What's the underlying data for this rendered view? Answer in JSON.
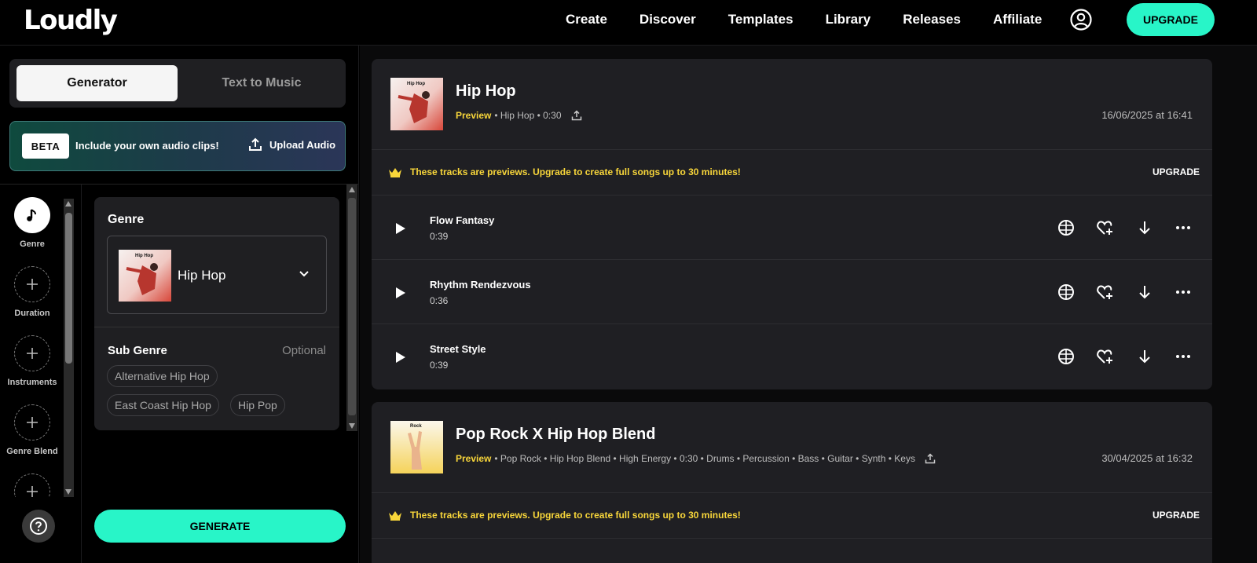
{
  "brand": {
    "logo": "Loudly"
  },
  "nav": {
    "items": [
      "Create",
      "Discover",
      "Templates",
      "Library",
      "Releases",
      "Affiliate"
    ],
    "upgrade_label": "UPGRADE"
  },
  "left": {
    "tabs": {
      "generator": "Generator",
      "text_to_music": "Text to Music"
    },
    "beta": {
      "badge": "BETA",
      "text": "Include your own audio clips!",
      "upload_label": "Upload Audio"
    },
    "rail": {
      "items": [
        {
          "label": "Genre",
          "icon": "music-note-icon"
        },
        {
          "label": "Duration",
          "icon": "plus-icon"
        },
        {
          "label": "Instruments",
          "icon": "plus-icon"
        },
        {
          "label": "Genre Blend",
          "icon": "plus-icon"
        },
        {
          "label": "",
          "icon": "plus-icon"
        }
      ]
    },
    "genre_card": {
      "title": "Genre",
      "selected": "Hip Hop",
      "cover_text": "Hip Hop",
      "sub_genre_label": "Sub Genre",
      "optional_label": "Optional",
      "chips": [
        "Alternative Hip Hop",
        "East Coast Hip Hop",
        "Hip Pop"
      ]
    },
    "generate_label": "GENERATE"
  },
  "content": {
    "cards": [
      {
        "title": "Hip Hop",
        "cover_text": "Hip Hop",
        "preview": "Preview",
        "meta": "• Hip Hop • 0:30",
        "date": "16/06/2025 at 16:41",
        "promo_text": "These tracks are previews. Upgrade to create full songs up to 30 minutes!",
        "promo_upgrade": "UPGRADE",
        "tracks": [
          {
            "name": "Flow Fantasy",
            "duration": "0:39"
          },
          {
            "name": "Rhythm Rendezvous",
            "duration": "0:36"
          },
          {
            "name": "Street Style",
            "duration": "0:39"
          }
        ]
      },
      {
        "title": "Pop Rock X Hip Hop Blend",
        "cover_text": "Rock",
        "preview": "Preview",
        "meta": "• Pop Rock • Hip Hop Blend • High Energy • 0:30 • Drums • Percussion • Bass • Guitar • Synth • Keys",
        "date": "30/04/2025 at 16:32",
        "promo_text": "These tracks are previews. Upgrade to create full songs up to 30 minutes!",
        "promo_upgrade": "UPGRADE"
      }
    ]
  },
  "colors": {
    "accent": "#28f5c8",
    "preview_yellow": "#f8d63a",
    "card_bg": "#1f1f23"
  }
}
